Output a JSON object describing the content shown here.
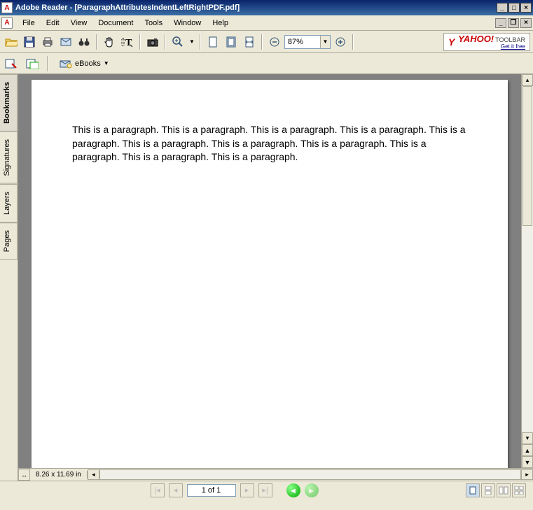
{
  "title": "Adobe Reader - [ParagraphAttributesIndentLeftRightPDF.pdf]",
  "menu": {
    "file": "File",
    "edit": "Edit",
    "view": "View",
    "document": "Document",
    "tools": "Tools",
    "window": "Window",
    "help": "Help"
  },
  "toolbar": {
    "zoom_value": "87%",
    "yahoo": {
      "brand": "YAHOO!",
      "t": "TOOLBAR",
      "free": "Get it free"
    }
  },
  "toolbar2": {
    "ebooks": "eBooks"
  },
  "nav_tabs": {
    "bookmarks": "Bookmarks",
    "signatures": "Signatures",
    "layers": "Layers",
    "pages": "Pages"
  },
  "page_content": "This is a paragraph. This is a paragraph. This is a paragraph. This is a paragraph. This is a paragraph. This is a paragraph. This is a paragraph. This is a paragraph. This is a paragraph. This is a paragraph. This is a paragraph.",
  "doc_dimensions": "8.26 x 11.69 in",
  "page_indicator": "1 of 1"
}
